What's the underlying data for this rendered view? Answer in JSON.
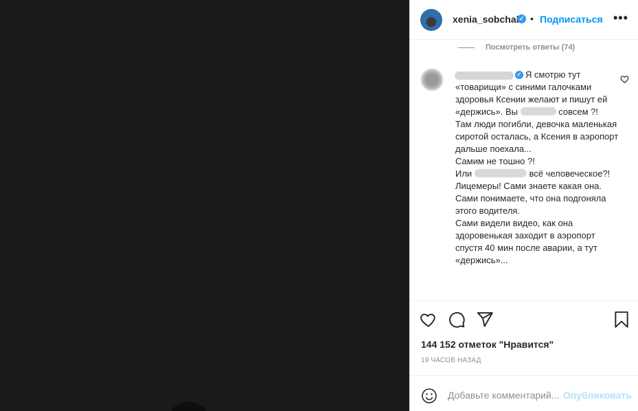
{
  "post": {
    "username": "xenia_sobchak",
    "follow_label": "Подписаться",
    "dot": "•",
    "more_label": "•••"
  },
  "comments": {
    "view_replies": "Посмотреть ответы (74)",
    "comment": {
      "first_line": "Я смотрю тут",
      "line2": "«товарищи» с синими галочками здоровья Ксении желают и пишут ей «держись». Вы",
      "line2_after": "совсем ?!",
      "p2": "Там люди погибли, девочка маленькая сиротой осталась, а Ксения в аэропорт дальше поехала...",
      "p3": "Самим не тошно ?!",
      "p4_before": "Или",
      "p4_after": "всё человеческое?!",
      "p5": "Лицемеры! Сами знаете какая она.",
      "p6": "Сами понимаете, что она подгоняла этого водителя.",
      "p7": "Сами видели видео, как она здоровенькая заходит в аэропорт спустя 40 мин после аварии, а тут «держись»..."
    }
  },
  "stats": {
    "likes": "144 152 отметок \"Нравится\"",
    "time": "19 ЧАСОВ НАЗАД"
  },
  "add_comment": {
    "placeholder": "Добавьте комментарий...",
    "publish_label": "Опубликовать"
  },
  "icons": {
    "like": "heart-icon",
    "comment": "comment-icon",
    "share": "paper-plane-icon",
    "save": "bookmark-icon",
    "emoji": "smiley-icon",
    "verified": "verified-badge-icon",
    "comment_like": "heart-icon"
  },
  "colors": {
    "accent": "#0095f6",
    "verified": "#3897f0",
    "muted": "#8e8e8e",
    "publish_disabled": "#b2dffc",
    "media_bg": "#1a1a1a"
  }
}
